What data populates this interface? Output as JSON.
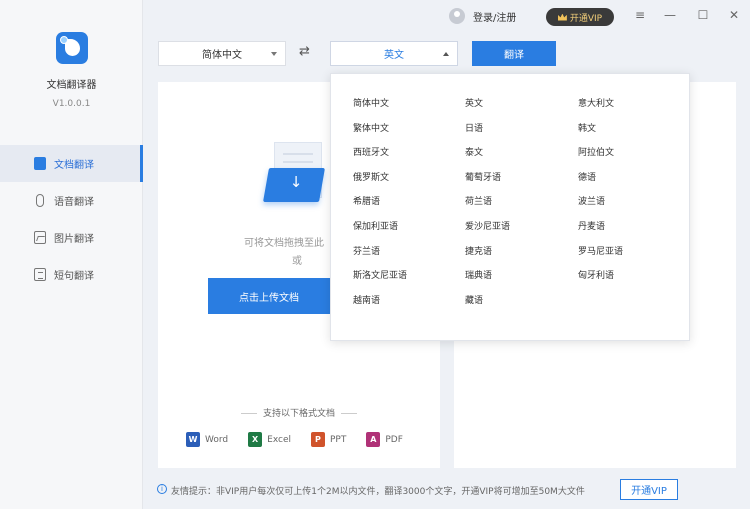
{
  "app": {
    "name": "文档翻译器",
    "version": "V1.0.0.1"
  },
  "sidebar": {
    "items": [
      {
        "label": "文档翻译",
        "icon": "document-icon",
        "active": true
      },
      {
        "label": "语音翻译",
        "icon": "microphone-icon",
        "active": false
      },
      {
        "label": "图片翻译",
        "icon": "image-icon",
        "active": false
      },
      {
        "label": "短句翻译",
        "icon": "sentence-icon",
        "active": false
      }
    ]
  },
  "header": {
    "login": "登录/注册",
    "vip": "开通VIP",
    "menu_icon": "≡",
    "minimize_icon": "—",
    "maximize_icon": "☐",
    "close_icon": "✕"
  },
  "toolbar": {
    "source_lang": "简体中文",
    "swap_icon": "⇄",
    "target_lang": "英文",
    "translate_label": "翻译"
  },
  "upload": {
    "drop_hint": "可将文档拖拽至此",
    "or": "或",
    "upload_label": "点击上传文档",
    "formats_title": "支持以下格式文档",
    "formats": [
      {
        "label": "Word",
        "letter": "W",
        "color": "#2b5eb8"
      },
      {
        "label": "Excel",
        "letter": "X",
        "color": "#1f7a45"
      },
      {
        "label": "PPT",
        "letter": "P",
        "color": "#d0532b"
      },
      {
        "label": "PDF",
        "letter": "A",
        "color": "#b03277"
      }
    ]
  },
  "dropdown": {
    "languages": [
      "简体中文",
      "英文",
      "意大利文",
      "繁体中文",
      "日语",
      "韩文",
      "西班牙文",
      "泰文",
      "阿拉伯文",
      "俄罗斯文",
      "葡萄牙语",
      "德语",
      "希腊语",
      "荷兰语",
      "波兰语",
      "保加利亚语",
      "爱沙尼亚语",
      "丹麦语",
      "芬兰语",
      "捷克语",
      "罗马尼亚语",
      "斯洛文尼亚语",
      "瑞典语",
      "匈牙利语",
      "越南语",
      "藏语"
    ]
  },
  "footer": {
    "tip": "友情提示：非VIP用户每次仅可上传1个2M以内文件，翻译3000个文字，开通VIP将可增加至50M大文件",
    "vip_label": "开通VIP"
  }
}
